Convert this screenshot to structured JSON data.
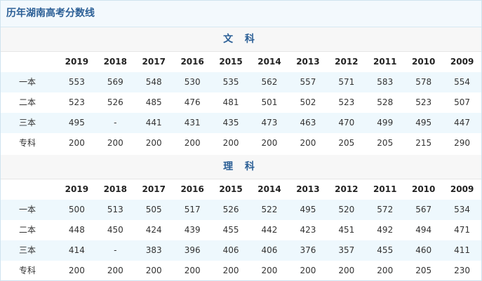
{
  "title": "历年湖南高考分数线",
  "sections": [
    {
      "name": "文 科",
      "years": [
        "2019",
        "2018",
        "2017",
        "2016",
        "2015",
        "2014",
        "2013",
        "2012",
        "2011",
        "2010",
        "2009"
      ],
      "rows": [
        {
          "label": "一本",
          "values": [
            "553",
            "569",
            "548",
            "530",
            "535",
            "562",
            "557",
            "571",
            "583",
            "578",
            "554"
          ]
        },
        {
          "label": "二本",
          "values": [
            "523",
            "526",
            "485",
            "476",
            "481",
            "501",
            "502",
            "523",
            "528",
            "523",
            "507"
          ]
        },
        {
          "label": "三本",
          "values": [
            "495",
            "-",
            "441",
            "431",
            "435",
            "473",
            "463",
            "470",
            "499",
            "495",
            "447"
          ]
        },
        {
          "label": "专科",
          "values": [
            "200",
            "200",
            "200",
            "200",
            "200",
            "200",
            "200",
            "205",
            "205",
            "215",
            "290"
          ]
        }
      ]
    },
    {
      "name": "理 科",
      "years": [
        "2019",
        "2018",
        "2017",
        "2016",
        "2015",
        "2014",
        "2013",
        "2012",
        "2011",
        "2010",
        "2009"
      ],
      "rows": [
        {
          "label": "一本",
          "values": [
            "500",
            "513",
            "505",
            "517",
            "526",
            "522",
            "495",
            "520",
            "572",
            "567",
            "534"
          ]
        },
        {
          "label": "二本",
          "values": [
            "448",
            "450",
            "424",
            "439",
            "455",
            "442",
            "423",
            "451",
            "492",
            "494",
            "471"
          ]
        },
        {
          "label": "三本",
          "values": [
            "414",
            "-",
            "383",
            "396",
            "406",
            "406",
            "376",
            "357",
            "455",
            "460",
            "411"
          ]
        },
        {
          "label": "专科",
          "values": [
            "200",
            "200",
            "200",
            "200",
            "200",
            "200",
            "200",
            "200",
            "200",
            "205",
            "230"
          ]
        }
      ]
    }
  ]
}
